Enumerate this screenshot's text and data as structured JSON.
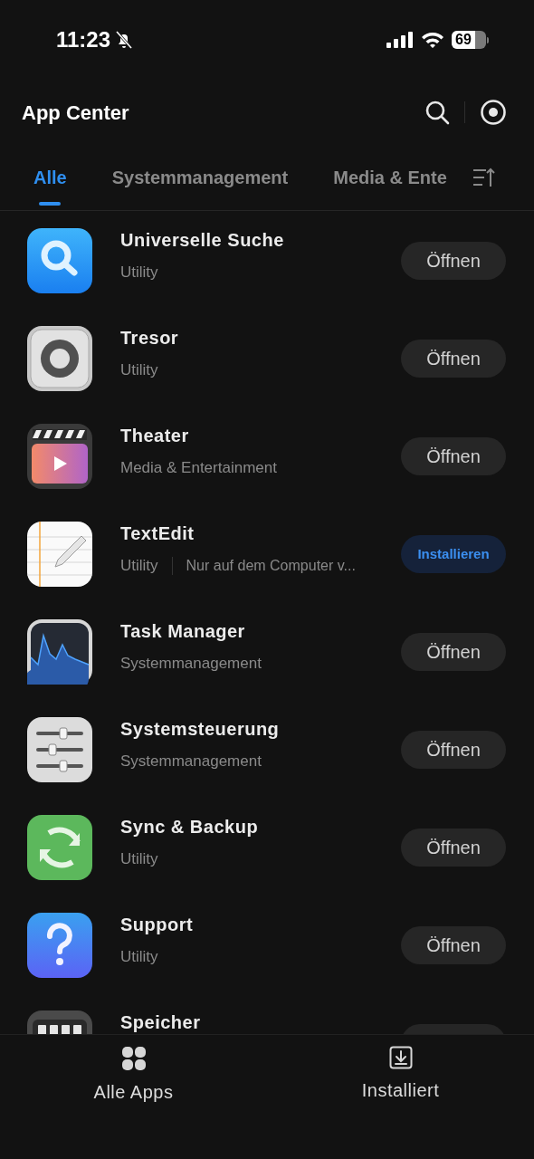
{
  "status_bar": {
    "time": "11:23",
    "battery": "69"
  },
  "header": {
    "title": "App Center"
  },
  "tabs": [
    {
      "label": "Alle",
      "selected": true
    },
    {
      "label": "Systemmanagement",
      "selected": false
    },
    {
      "label": "Media & Ente",
      "selected": false
    }
  ],
  "apps": [
    {
      "kind": "search",
      "name": "Universelle Suche",
      "category": "Utility",
      "action": {
        "kind": "open",
        "label": "Öffnen"
      }
    },
    {
      "kind": "safe",
      "name": "Tresor",
      "category": "Utility",
      "action": {
        "kind": "open",
        "label": "Öffnen"
      }
    },
    {
      "kind": "clapper",
      "name": "Theater",
      "category": "Media & Entertainment",
      "action": {
        "kind": "open",
        "label": "Öffnen"
      }
    },
    {
      "kind": "notes",
      "name": "TextEdit",
      "category": "Utility",
      "note": "Nur auf dem Computer v...",
      "action": {
        "kind": "install",
        "label": "Installieren"
      }
    },
    {
      "kind": "chart",
      "name": "Task Manager",
      "category": "Systemmanagement",
      "action": {
        "kind": "open",
        "label": "Öffnen"
      }
    },
    {
      "kind": "sliders",
      "name": "Systemsteuerung",
      "category": "Systemmanagement",
      "action": {
        "kind": "open",
        "label": "Öffnen"
      }
    },
    {
      "kind": "sync",
      "name": "Sync & Backup",
      "category": "Utility",
      "action": {
        "kind": "open",
        "label": "Öffnen"
      }
    },
    {
      "kind": "help",
      "name": "Support",
      "category": "Utility",
      "action": {
        "kind": "open",
        "label": "Öffnen"
      }
    },
    {
      "kind": "storage",
      "name": "Speicher",
      "action": {
        "kind": "open"
      }
    }
  ],
  "bottom_nav": [
    {
      "label": "Alle Apps"
    },
    {
      "label": "Installiert"
    }
  ]
}
